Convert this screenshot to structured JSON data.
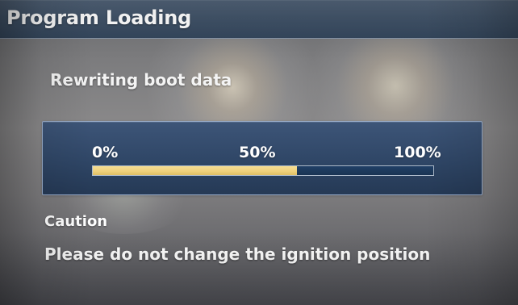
{
  "header": {
    "title": "Program Loading"
  },
  "status": {
    "message": "Rewriting boot data"
  },
  "progress": {
    "start_label": "0%",
    "mid_label": "50%",
    "end_label": "100%",
    "value_fraction": 0.6
  },
  "caution": {
    "title": "Caution",
    "text": "Please do not change the ignition position"
  },
  "colors": {
    "header": "#455a72",
    "panel": "#324a6c",
    "fill": "#efd17d",
    "track": "#1c3756"
  }
}
